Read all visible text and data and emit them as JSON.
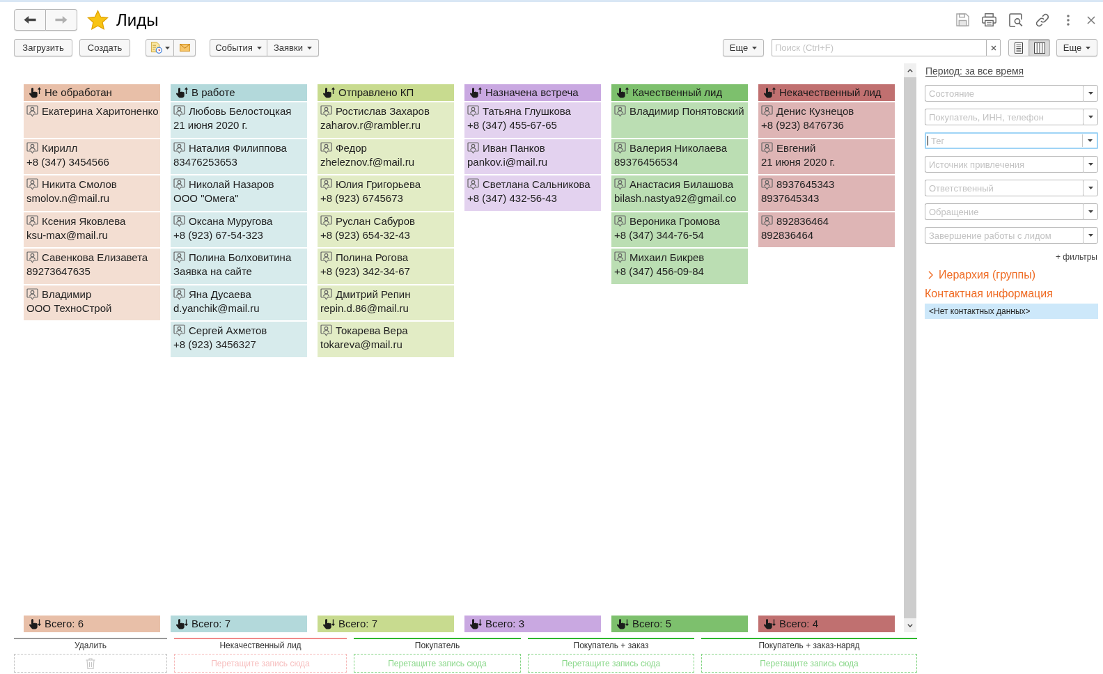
{
  "window": {
    "title": "Лиды",
    "favorite": true
  },
  "navigation": [
    {
      "kind": "back",
      "disabled": false
    },
    {
      "kind": "forward",
      "disabled": true
    }
  ],
  "toolbar": {
    "buttons": [
      {
        "label": "Загрузить"
      },
      {
        "label": "Создать"
      }
    ],
    "menus": [
      {
        "label": "События"
      },
      {
        "label": "Заявки"
      }
    ],
    "more_left": {
      "label": "Еще"
    },
    "search": {
      "placeholder": "Поиск (Ctrl+F)"
    },
    "view_modes": [
      {
        "kind": "list",
        "selected": false
      },
      {
        "kind": "columns",
        "selected": true
      }
    ],
    "more_right": {
      "label": "Еще"
    }
  },
  "columns": [
    {
      "title": "Не обработан",
      "color": "#e8bfa8",
      "total": "Всего: 6",
      "cards": [
        {
          "name": "Екатерина Харитоненко"
        },
        {
          "name": "Кирилл",
          "detail": "+8 (347) 3454566"
        },
        {
          "name": "Никита Смолов",
          "detail": "smolov.n@mail.ru"
        },
        {
          "name": "Ксения Яковлева",
          "detail": "ksu-max@mail.ru"
        },
        {
          "name": "Савенкова Елизавета",
          "detail": "89273647635"
        },
        {
          "name": "Владимир",
          "detail": "ООО ТехноСтрой"
        }
      ]
    },
    {
      "title": "В работе",
      "color": "#b3d9db",
      "total": "Всего: 7",
      "cards": [
        {
          "name": "Любовь Белостоцкая",
          "detail": "21 июня 2020 г."
        },
        {
          "name": "Наталия Филиппова",
          "detail": "83476253653"
        },
        {
          "name": "Николай Назаров",
          "detail": "ООО \"Омега\""
        },
        {
          "name": "Оксана Муругова",
          "detail": "+8 (923) 67-54-323"
        },
        {
          "name": "Полина Болховитина",
          "detail": "Заявка на сайте"
        },
        {
          "name": "Яна Дусаева",
          "detail": "d.yanchik@mail.ru"
        },
        {
          "name": "Сергей Ахметов",
          "detail": "+8 (923) 3456327"
        }
      ]
    },
    {
      "title": "Отправлено КП",
      "color": "#c8db8f",
      "total": "Всего: 7",
      "cards": [
        {
          "name": "Ростислав Захаров",
          "detail": "zaharov.r@rambler.ru"
        },
        {
          "name": "Федор",
          "detail": "zheleznov.f@mail.ru"
        },
        {
          "name": "Юлия Григорьева",
          "detail": "+8 (923) 6745673"
        },
        {
          "name": "Руслан Сабуров",
          "detail": "+8 (923) 654-32-43"
        },
        {
          "name": "Полина Рогова",
          "detail": "+8 (923) 342-34-67"
        },
        {
          "name": "Дмитрий Репин",
          "detail": "repin.d.86@mail.ru"
        },
        {
          "name": "Токарева Вера",
          "detail": "tokareva@mail.ru"
        }
      ]
    },
    {
      "title": "Назначена встреча",
      "color": "#c9a8e1",
      "total": "Всего: 3",
      "cards": [
        {
          "name": "Татьяна Глушкова",
          "detail": "+8 (347) 455-67-65"
        },
        {
          "name": "Иван Панков",
          "detail": "pankov.i@mail.ru"
        },
        {
          "name": "Светлана Сальникова",
          "detail": "+8 (347) 432-56-43"
        }
      ]
    },
    {
      "title": "Качественный лид",
      "color": "#7dc06d",
      "total": "Всего: 5",
      "cards": [
        {
          "name": "Владимир Понятовский"
        },
        {
          "name": "Валерия Николаева",
          "detail": "89376456534"
        },
        {
          "name": "Анастасия Билашова",
          "detail": "bilash.nastya92@gmail.co"
        },
        {
          "name": "Вероника Громова",
          "detail": "+8 (347) 344-76-54"
        },
        {
          "name": "Михаил Бикрев",
          "detail": "+8 (347) 456-09-84"
        }
      ]
    },
    {
      "title": "Некачественный лид",
      "color": "#c07070",
      "total": "Всего: 4",
      "cards": [
        {
          "name": "Денис Кузнецов",
          "detail": "+8 (923) 8476736"
        },
        {
          "name": "Евгений",
          "detail": "21 июня 2020 г."
        },
        {
          "name": "8937645343",
          "detail": "8937645343"
        },
        {
          "name": "892836464",
          "detail": "892836464"
        }
      ]
    }
  ],
  "drop_zones": [
    {
      "label": "Удалить",
      "kind": "delete",
      "color": "#9a9a9a"
    },
    {
      "label": "Некачественный лид",
      "kind": "target",
      "color": "#f08a8a",
      "hint": "Перетащите запись сюда"
    },
    {
      "label": "Покупатель",
      "kind": "target",
      "color": "#2eb82e",
      "hint": "Перетащите запись сюда"
    },
    {
      "label": "Покупатель + заказ",
      "kind": "target",
      "color": "#2eb82e",
      "hint": "Перетащите запись сюда"
    },
    {
      "label": "Покупатель + заказ-наряд",
      "kind": "target",
      "color": "#2eb82e",
      "hint": "Перетащите запись сюда"
    }
  ],
  "side_panel": {
    "period": "Период: за все время",
    "filters": [
      {
        "placeholder": "Состояние",
        "focused": false
      },
      {
        "placeholder": "Покупатель, ИНН, телефон",
        "focused": false
      },
      {
        "placeholder": "Тег",
        "focused": true
      },
      {
        "placeholder": "Источник привлечения",
        "focused": false
      },
      {
        "placeholder": "Ответственный",
        "focused": false
      },
      {
        "placeholder": "Обращение",
        "focused": false
      },
      {
        "placeholder": "Завершение работы с лидом",
        "focused": false
      }
    ],
    "add_filters": "+ фильтры",
    "hierarchy": {
      "label": "Иерархия (группы)",
      "expanded": false
    },
    "contact_title": "Контактная информация",
    "contact_value": "<Нет контактных данных>"
  }
}
